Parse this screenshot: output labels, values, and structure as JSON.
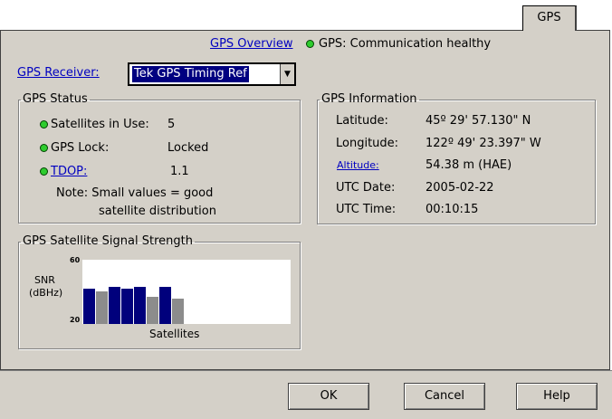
{
  "tab": {
    "label": "GPS"
  },
  "header": {
    "overview_link": "GPS Overview",
    "status_text": "GPS: Communication healthy",
    "receiver_label": "GPS Receiver:",
    "receiver_value": "Tek GPS Timing Ref"
  },
  "status": {
    "legend": "GPS Status",
    "rows": [
      {
        "label": "Satellites in Use:",
        "value": "5"
      },
      {
        "label": "GPS Lock:",
        "value": "Locked"
      },
      {
        "label": "TDOP:",
        "value": "1.1"
      }
    ],
    "note_line1": "Note: Small values = good",
    "note_line2": "satellite distribution"
  },
  "info": {
    "legend": "GPS Information",
    "rows": [
      {
        "label": "Latitude:",
        "value": "45º 29' 57.130\" N"
      },
      {
        "label": "Longitude:",
        "value": "122º 49' 23.397\" W"
      },
      {
        "label": "Altitude:",
        "value": "54.38 m (HAE)"
      },
      {
        "label": "UTC Date:",
        "value": "2005-02-22"
      },
      {
        "label": "UTC Time:",
        "value": "00:10:15"
      }
    ]
  },
  "signal": {
    "legend": "GPS Satellite Signal Strength",
    "ylabel_line1": "SNR",
    "ylabel_line2": "(dBHz)",
    "xlabel": "Satellites",
    "ymax_label": "60",
    "ymin_label": "20"
  },
  "chart_data": {
    "type": "bar",
    "title": "GPS Satellite Signal Strength",
    "xlabel": "Satellites",
    "ylabel": "SNR (dBHz)",
    "ylim": [
      20,
      60
    ],
    "values": [
      42,
      40,
      43,
      42,
      43,
      37,
      43,
      36
    ],
    "colors": [
      "#00007c",
      "#8c8c8c",
      "#00007c",
      "#00007c",
      "#00007c",
      "#8c8c8c",
      "#00007c",
      "#8c8c8c"
    ],
    "grid": false
  },
  "buttons": {
    "ok": "OK",
    "cancel": "Cancel",
    "help": "Help"
  },
  "colors": {
    "led": "#2ecc2e",
    "panel": "#d4d0c8",
    "link": "#0000c0",
    "selection": "#000080"
  }
}
